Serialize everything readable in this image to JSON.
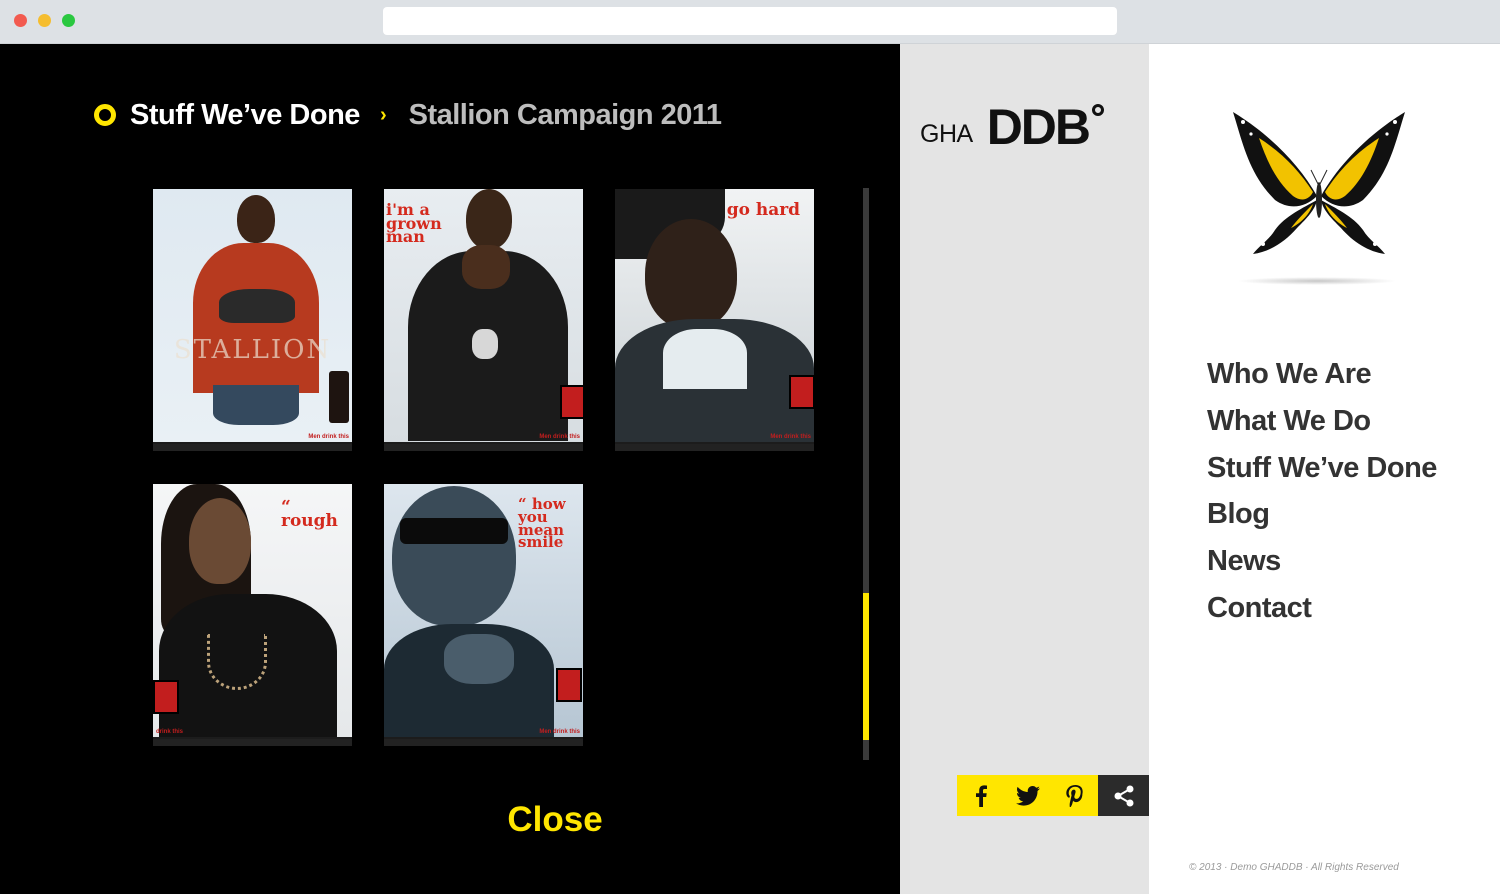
{
  "breadcrumb": {
    "current": "Stuff We’ve Done",
    "separator": "›",
    "sub": "Stallion Campaign 2011"
  },
  "gallery": {
    "thumbnails": [
      {
        "headline": "",
        "tagline": "Men drink this"
      },
      {
        "headline": "i'm a grown man",
        "tagline": "Men drink this"
      },
      {
        "headline": "“ go hard",
        "tagline": "Men drink this"
      },
      {
        "headline": "“ rough",
        "tagline": "drink this"
      },
      {
        "headline": "“ how you mean smile",
        "tagline": "Men drink this"
      }
    ],
    "close_label": "Close"
  },
  "logo": {
    "gha": "GHA",
    "ddb": "DDB"
  },
  "share": {
    "facebook": "f",
    "twitter": "t",
    "pinterest": "p",
    "icons": [
      "facebook-icon",
      "twitter-icon",
      "pinterest-icon",
      "share-icon"
    ]
  },
  "nav": {
    "items": [
      "Who We Are",
      "What We Do",
      "Stuff We’ve Done",
      "Blog",
      "News",
      "Contact"
    ]
  },
  "footer": {
    "text": "© 2013  ·  Demo GHADDB  ·  All Rights Reserved"
  },
  "colors": {
    "accent": "#ffe600",
    "panel_dark": "#000000",
    "panel_grey": "#e4e4e4",
    "brand_red": "#c21e1e"
  }
}
